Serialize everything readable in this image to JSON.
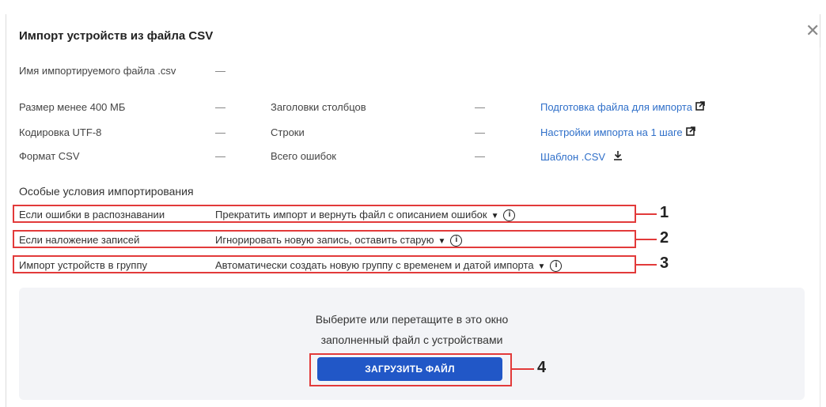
{
  "dialog": {
    "title": "Импорт устройств из файла CSV",
    "close_label": "✕"
  },
  "file": {
    "label": "Имя импортируемого файла .csv",
    "value": "—"
  },
  "requirements": [
    {
      "label": "Размер менее 400 МБ",
      "value": "—"
    },
    {
      "label": "Кодировка UTF-8",
      "value": "—"
    },
    {
      "label": "Формат CSV",
      "value": "—"
    }
  ],
  "stats": [
    {
      "label": "Заголовки столбцов",
      "value": "—"
    },
    {
      "label": "Строки",
      "value": "—"
    },
    {
      "label": "Всего ошибок",
      "value": "—"
    }
  ],
  "links": [
    {
      "label": "Подготовка файла для импорта",
      "icon": "external-link-icon"
    },
    {
      "label": "Настройки импорта на 1 шаге",
      "icon": "external-link-icon"
    },
    {
      "label": "Шаблон .CSV",
      "icon": "download-icon"
    }
  ],
  "conditions": {
    "title": "Особые условия импортирования",
    "items": [
      {
        "label": "Если ошибки в распознавании",
        "value": "Прекратить импорт и вернуть файл с описанием ошибок",
        "callout": "1"
      },
      {
        "label": "Если наложение записей",
        "value": "Игнорировать новую запись, оставить старую",
        "callout": "2"
      },
      {
        "label": "Импорт устройств в группу",
        "value": "Автоматически создать новую группу с временем и датой импорта",
        "callout": "3"
      }
    ]
  },
  "dropzone": {
    "line1": "Выберите или перетащите в это окно",
    "line2": "заполненный файл с устройствами",
    "button_label": "ЗАГРУЗИТЬ ФАЙЛ",
    "callout": "4"
  },
  "colors": {
    "accent": "#2157c7",
    "link": "#2f6fc9",
    "highlight": "#e23a3a"
  }
}
